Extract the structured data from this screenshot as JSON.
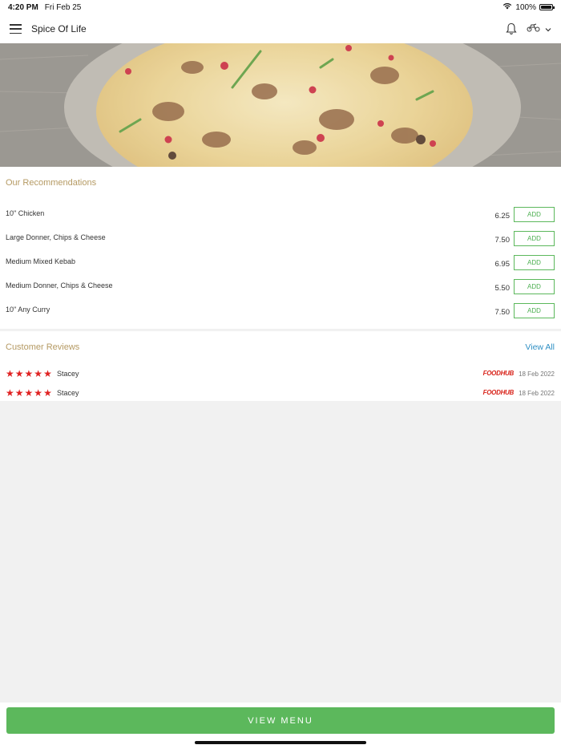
{
  "status": {
    "time": "4:20 PM",
    "date": "Fri Feb 25",
    "battery": "100%",
    "battery_level": 1.0
  },
  "header": {
    "title": "Spice Of Life",
    "icons": [
      "menu-icon",
      "bell-icon",
      "delivery-scooter-icon",
      "chevron-down-icon"
    ]
  },
  "recommendations": {
    "title": "Our Recommendations",
    "add_label": "ADD",
    "items": [
      {
        "name": "10\" Chicken",
        "price": "6.25"
      },
      {
        "name": "Large Donner, Chips & Cheese",
        "price": "7.50"
      },
      {
        "name": "Medium Mixed Kebab",
        "price": "6.95"
      },
      {
        "name": "Medium Donner, Chips & Cheese",
        "price": "5.50"
      },
      {
        "name": "10\" Any Curry",
        "price": "7.50"
      }
    ]
  },
  "reviews": {
    "title": "Customer Reviews",
    "view_all": "View All",
    "items": [
      {
        "rating": 5,
        "name": "Stacey",
        "source": "FOODHUB",
        "date": "18 Feb 2022"
      },
      {
        "rating": 5,
        "name": "Stacey",
        "source": "FOODHUB",
        "date": "18 Feb 2022"
      }
    ]
  },
  "footer": {
    "view_menu": "VIEW MENU"
  },
  "colors": {
    "accent_green": "#5cb85c",
    "section_title": "#b59a63",
    "link_blue": "#2f8fc4",
    "star_red": "#e02222"
  }
}
